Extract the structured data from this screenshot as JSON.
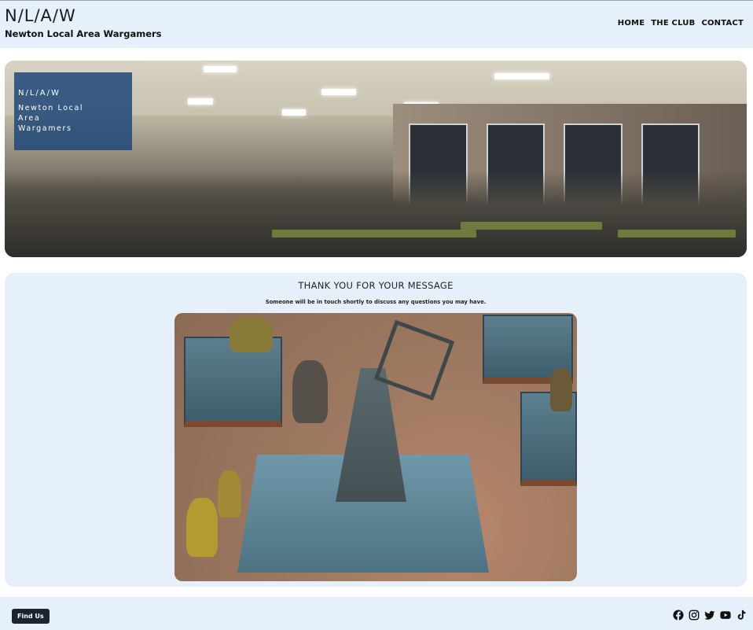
{
  "header": {
    "brand_mark": "N/L/A/W",
    "brand_name": "Newton Local Area Wargamers",
    "nav": [
      "HOME",
      "THE CLUB",
      "CONTACT"
    ]
  },
  "hero": {
    "overlay_mark": "N/L/A/W",
    "overlay_name": "Newton Local Area Wargamers"
  },
  "message": {
    "title": "THANK YOU FOR YOUR MESSAGE",
    "subtitle": "Someone will be in touch shortly to discuss any questions you may have."
  },
  "footer": {
    "find_us": "Find Us",
    "social_icons": [
      "facebook-icon",
      "instagram-icon",
      "twitter-icon",
      "youtube-icon",
      "tiktok-icon"
    ]
  },
  "colors": {
    "panel_bg": "#e6f0fa",
    "overlay_bg": "#1e4678",
    "button_bg": "#1b2430"
  }
}
